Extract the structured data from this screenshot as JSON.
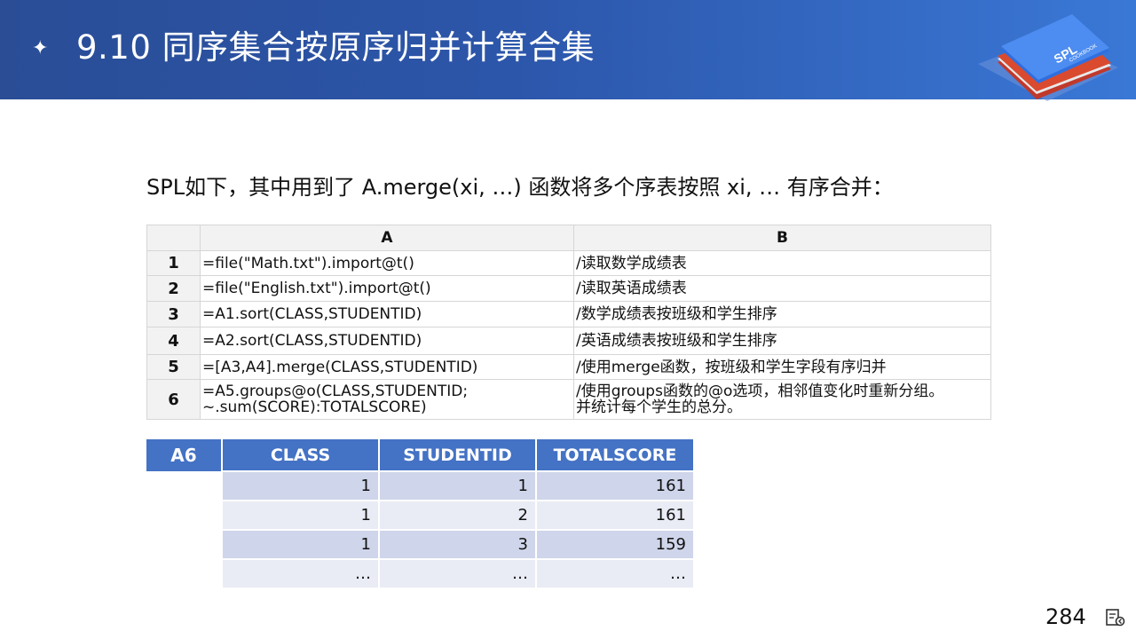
{
  "slide": {
    "title": "9.10 同序集合按原序归并计算合集",
    "intro": "SPL如下，其中用到了 A.merge(xi, …) 函数将多个序表按照 xi, … 有序合并：",
    "page_number": "284",
    "logo_text": "SPL",
    "logo_subtext": "COOKBOOK",
    "icons": {
      "bullet": "star-bullet-icon",
      "nav": "slide-navigation-icon"
    },
    "colors": {
      "header": "#2c56aa",
      "result_header": "#4472c4"
    }
  },
  "code_table": {
    "columns": [
      "A",
      "B"
    ],
    "rows": [
      {
        "num": "1",
        "a": [
          "=file(\"Math.txt\").import@t()"
        ],
        "b": [
          "/读取数学成绩表"
        ]
      },
      {
        "num": "2",
        "a": [
          "=file(\"English.txt\").import@t()"
        ],
        "b": [
          "/读取英语成绩表"
        ]
      },
      {
        "num": "3",
        "a": [
          "=A1.sort(CLASS,STUDENTID)"
        ],
        "b": [
          "/数学成绩表按班级和学生排序"
        ]
      },
      {
        "num": "4",
        "a": [
          "=A2.sort(CLASS,STUDENTID)"
        ],
        "b": [
          "/英语成绩表按班级和学生排序"
        ]
      },
      {
        "num": "5",
        "a": [
          "=[A3,A4].merge(CLASS,STUDENTID)"
        ],
        "b": [
          "/使用merge函数，按班级和学生字段有序归并"
        ]
      },
      {
        "num": "6",
        "a": [
          "=A5.groups@o(CLASS,STUDENTID;",
          "~.sum(SCORE):TOTALSCORE)"
        ],
        "b": [
          "/使用groups函数的@o选项，相邻值变化时重新分组。",
          "并统计每个学生的总分。"
        ]
      }
    ]
  },
  "result_table": {
    "label": "A6",
    "columns": [
      "CLASS",
      "STUDENTID",
      "TOTALSCORE"
    ],
    "rows": [
      [
        "1",
        "1",
        "161"
      ],
      [
        "1",
        "2",
        "161"
      ],
      [
        "1",
        "3",
        "159"
      ],
      [
        "…",
        "…",
        "…"
      ]
    ]
  }
}
